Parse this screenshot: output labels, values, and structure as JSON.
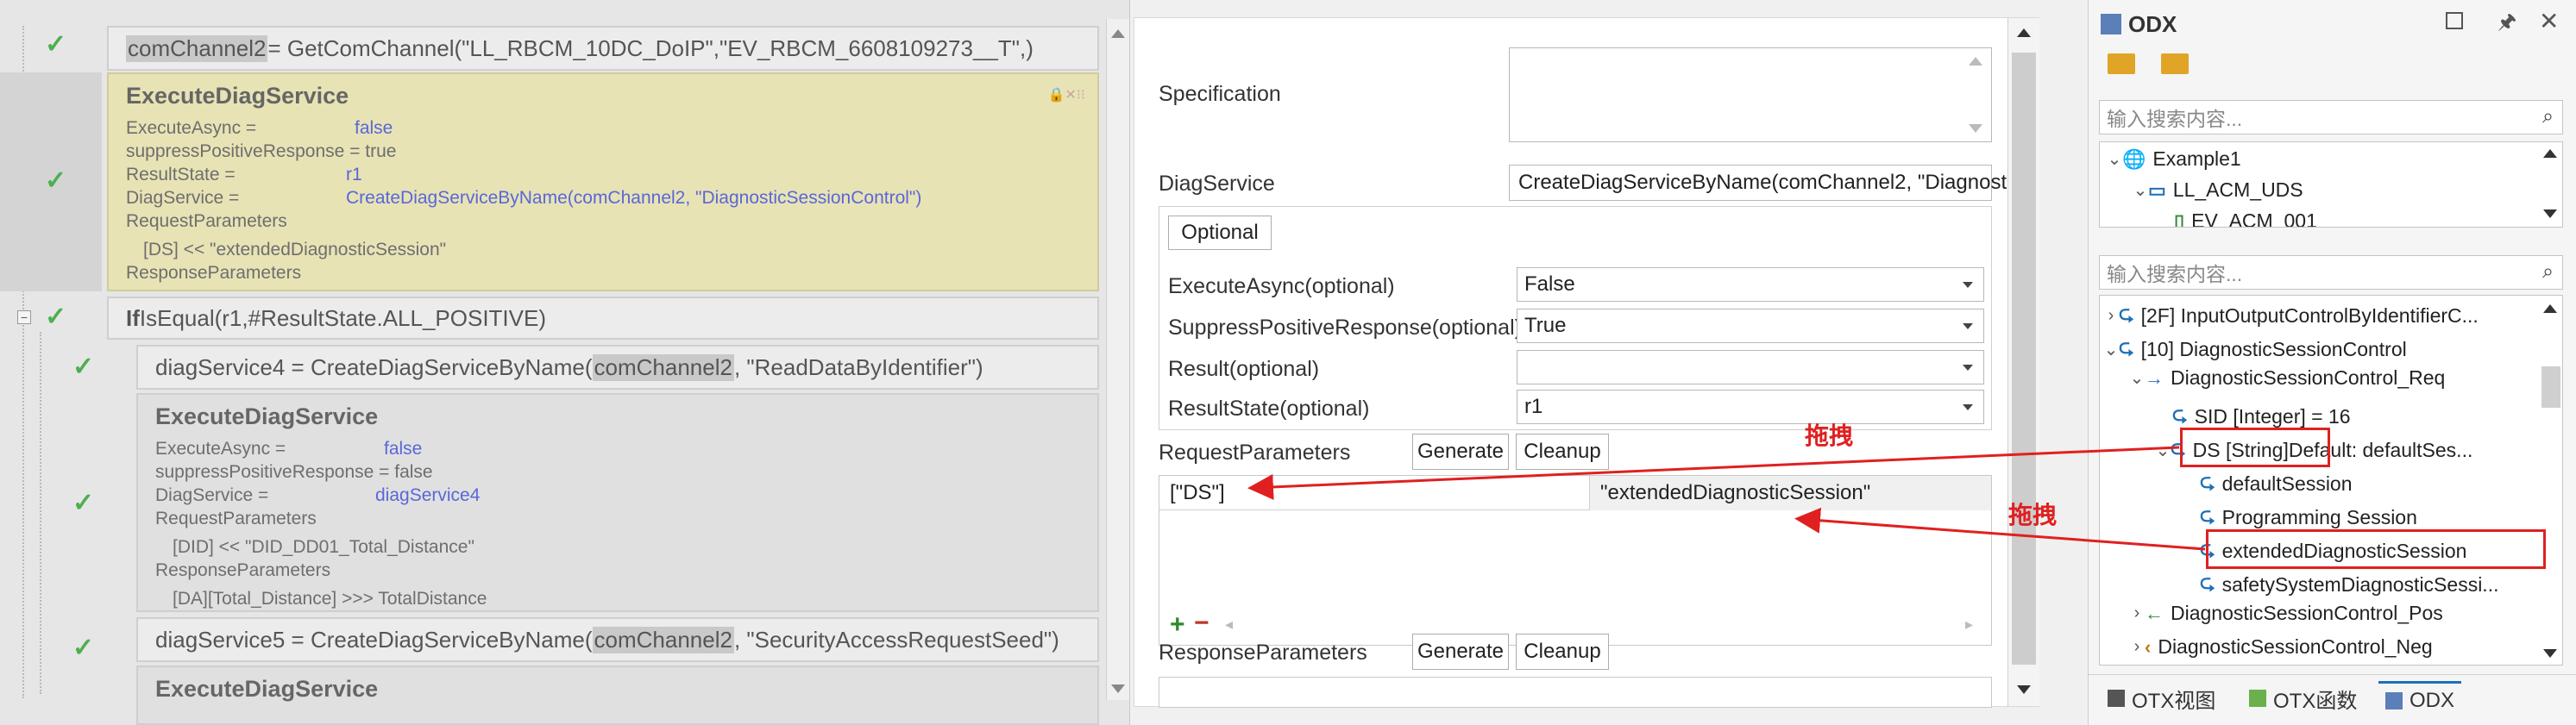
{
  "code": {
    "line1": {
      "var": "comChannel2",
      "rest": " = GetComChannel(\"LL_RBCM_10DC_DoIP\",\"EV_RBCM_6608109273__T\",)"
    },
    "block1": {
      "title": "ExecuteDiagService",
      "rows": [
        {
          "k": "ExecuteAsync =",
          "v": "false"
        },
        {
          "k": "suppressPositiveResponse = true",
          "v": ""
        },
        {
          "k": "ResultState =",
          "v": "r1"
        },
        {
          "k": " DiagService =",
          "v": "CreateDiagServiceByName(comChannel2, \"DiagnosticSessionControl\")"
        },
        {
          "k": "RequestParameters",
          "v": ""
        },
        {
          "k": "  [DS] << \"extendedDiagnosticSession\"",
          "v": ""
        },
        {
          "k": "ResponseParameters",
          "v": ""
        }
      ],
      "icons": "🔒✕⁝⁝"
    },
    "line2": {
      "kw": "If",
      "rest": " IsEqual(r1,#ResultState.ALL_POSITIVE)"
    },
    "line3": {
      "pre": "diagService4 = CreateDiagServiceByName(",
      "var": "comChannel2",
      "post": ", \"ReadDataByIdentifier\")"
    },
    "block2": {
      "title": "ExecuteDiagService",
      "rows": [
        {
          "k": "ExecuteAsync =",
          "v": "false"
        },
        {
          "k": "suppressPositiveResponse = false",
          "v": ""
        },
        {
          "k": "DiagService =",
          "v": "diagService4"
        },
        {
          "k": "RequestParameters",
          "v": ""
        },
        {
          "k": "  [DID] << \"DID_DD01_Total_Distance\"",
          "v": ""
        },
        {
          "k": "ResponseParameters",
          "v": ""
        },
        {
          "k": "  [DA][Total_Distance] >>> TotalDistance",
          "v": ""
        }
      ]
    },
    "line4": {
      "pre": "diagService5 = CreateDiagServiceByName(",
      "var": "comChannel2",
      "post": ", \"SecurityAccessRequestSeed\")"
    },
    "block3": {
      "title": "ExecuteDiagService"
    }
  },
  "props": {
    "specification_label": "Specification",
    "specification_value": "",
    "diagservice_label": "DiagService",
    "diagservice_value": "CreateDiagServiceByName(comChannel2, \"Diagnostic",
    "optional_tab": "Optional",
    "optional_rows": [
      {
        "label": "ExecuteAsync(optional)",
        "value": "False"
      },
      {
        "label": "SuppressPositiveResponse(optional)",
        "value": "True"
      },
      {
        "label": "Result(optional)",
        "value": ""
      },
      {
        "label": "ResultState(optional)",
        "value": "r1"
      }
    ],
    "request_label": "RequestParameters",
    "generate": "Generate",
    "cleanup": "Cleanup",
    "request_rows": [
      {
        "key": "[\"DS\"]",
        "value": "\"extendedDiagnosticSession\""
      }
    ],
    "add": "+",
    "remove": "−",
    "response_label": "ResponseParameters"
  },
  "annotations": {
    "drag1": "拖拽",
    "drag2": "拖拽"
  },
  "odx": {
    "title": "ODX",
    "search1_placeholder": "输入搜索内容...",
    "search2_placeholder": "输入搜索内容...",
    "tree1": [
      {
        "label": "Example1"
      },
      {
        "label": "LL_ACM_UDS"
      },
      {
        "label": "EV_ACM_001"
      }
    ],
    "tree2": [
      {
        "label": "[2F] InputOutputControlByIdentifierC..."
      },
      {
        "label": "[10] DiagnosticSessionControl"
      },
      {
        "label": "DiagnosticSessionControl_Req"
      },
      {
        "label": "SID [Integer] = 16"
      },
      {
        "label": "DS [String]",
        "extra": " Default: defaultSes..."
      },
      {
        "label": "defaultSession"
      },
      {
        "label": "Programming Session"
      },
      {
        "label": "extendedDiagnosticSession"
      },
      {
        "label": "safetySystemDiagnosticSessi..."
      },
      {
        "label": "DiagnosticSessionControl_Pos"
      },
      {
        "label": "DiagnosticSessionControl_Neg"
      }
    ],
    "tabs": [
      {
        "label": "OTX视图"
      },
      {
        "label": "OTX函数"
      },
      {
        "label": "ODX"
      }
    ],
    "colors": {
      "accent": "#1e6fb8",
      "red": "#e02020"
    }
  }
}
